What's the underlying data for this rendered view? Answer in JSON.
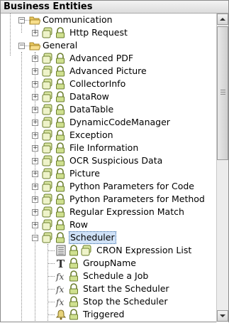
{
  "panel": {
    "title": "Business Entities"
  },
  "tree": {
    "communication": {
      "label": "Communication",
      "children": [
        "Http Request"
      ]
    },
    "general": {
      "label": "General",
      "children": [
        "Advanced PDF",
        "Advanced Picture",
        "CollectorInfo",
        "DataRow",
        "DataTable",
        "DynamicCodeManager",
        "Exception",
        "File Information",
        "OCR Suspicious Data",
        "Picture",
        "Python Parameters for Code",
        "Python Parameters for Method",
        "Regular Expression Match",
        "Row"
      ],
      "scheduler": {
        "label": "Scheduler",
        "children": [
          "CRON Expression List",
          "GroupName",
          "Schedule a Job",
          "Start the Scheduler",
          "Stop the Scheduler",
          "Triggered"
        ]
      }
    }
  },
  "icons": {
    "folder": "folder-icon",
    "entity": "entity-icon",
    "lock": "lock-icon",
    "list": "list-icon",
    "text": "text-type-icon",
    "function": "function-icon",
    "event": "event-bell-icon"
  },
  "colors": {
    "selection": "#cfe1f7",
    "folder": "#e7c85b"
  }
}
